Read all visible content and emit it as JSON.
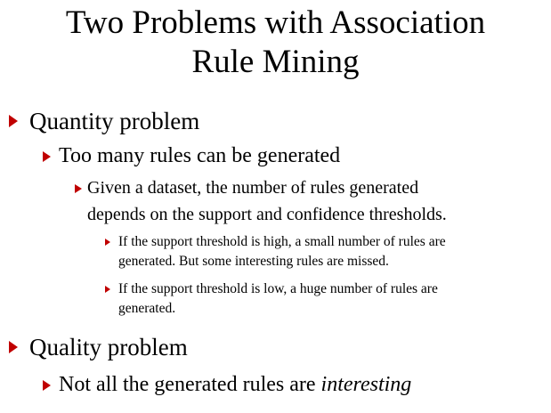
{
  "slide": {
    "title_line1": "Two Problems with Association",
    "title_line2": "Rule Mining",
    "colors": {
      "bullet": "#c00000",
      "text": "#000000",
      "background": "#ffffff"
    },
    "bullet_icon": "red-triangle-arrow",
    "bullets": {
      "quantity": "Quantity problem",
      "too_many": "Too many rules can be generated",
      "given_line1": "Given a dataset, the number of rules generated",
      "given_line2": "depends on the support and confidence thresholds.",
      "high_line1": "If the support threshold is high, a small number of rules are",
      "high_line2": "generated. But some interesting rules are missed.",
      "low_line1": "If the support threshold is low, a huge number of rules are",
      "low_line2": "generated.",
      "quality": "Quality problem",
      "not_all_prefix": "Not all the generated rules are ",
      "not_all_emphasis": "interesting"
    }
  }
}
